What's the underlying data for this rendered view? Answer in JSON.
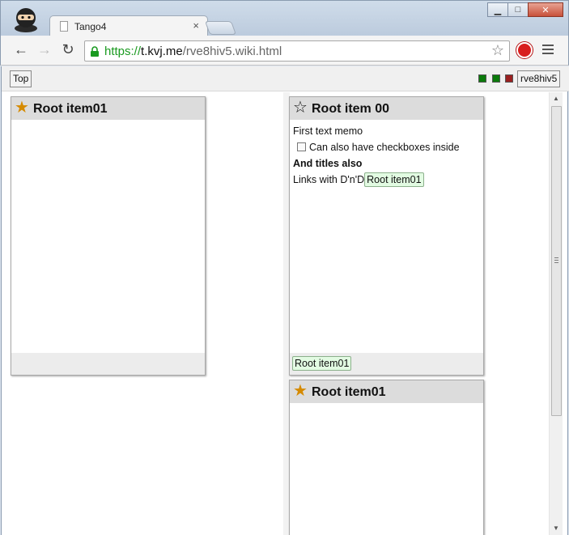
{
  "browser": {
    "tab_title": "Tango4",
    "tab_close": "×",
    "url_scheme": "https://",
    "url_host": "t.kvj.me",
    "url_path": "/rve8hiv5.wiki.html",
    "back_glyph": "←",
    "forward_glyph": "→",
    "reload_glyph": "↻",
    "bookmark_glyph": "☆",
    "minimize_glyph": "▁",
    "maximize_glyph": "□",
    "close_glyph": "✕"
  },
  "topbar": {
    "top_button": "Top",
    "page_button": "rve8hiv5",
    "indicators": [
      "#0b7a0b",
      "#0b7a0b",
      "#9a1f1f"
    ]
  },
  "cards": {
    "left": {
      "title": "Root item01",
      "starred": true
    },
    "right_top": {
      "title": "Root item 00",
      "starred": false,
      "memo_text": "First text memo",
      "checkbox_label": "Can also have checkboxes inside",
      "checkbox_checked": false,
      "bold_title": "And titles also",
      "links_text": "Links with D'n'D",
      "inline_link": "Root item01",
      "footer_link": "Root item01"
    },
    "right_bottom": {
      "title": "Root item01",
      "starred": true
    }
  },
  "icons": {
    "filled_star": "★",
    "empty_star": "☆",
    "scroll_up": "▲",
    "scroll_down": "▼"
  },
  "colors": {
    "star_accent": "#d58a00",
    "link_chip_bg": "#e2fbe2",
    "card_header_bg": "#dcdcdc",
    "url_scheme": "#1a9a20"
  }
}
